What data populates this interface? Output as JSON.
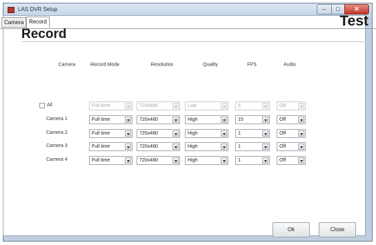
{
  "window": {
    "title": "LAS DVR Setup",
    "controls": {
      "minimize": "–",
      "maximize": "□",
      "close": "✕"
    }
  },
  "tabs": [
    {
      "label": "Camera",
      "active": false
    },
    {
      "label": "Record",
      "active": true
    }
  ],
  "corner_title": "Test",
  "section_title": "Record",
  "columns": [
    "Camera",
    "Record Mode",
    "Resolution",
    "Quality",
    "FPS",
    "Audio"
  ],
  "all_row": {
    "label": "All",
    "checked": false,
    "record_mode": "Full time",
    "resolution": "720x480",
    "quality": "Low",
    "fps": "6",
    "audio": "Off"
  },
  "rows": [
    {
      "camera": "Camera 1",
      "record_mode": "Full time",
      "resolution": "720x480",
      "quality": "High",
      "fps": "15",
      "audio": "Off"
    },
    {
      "camera": "Camera 2",
      "record_mode": "Full time",
      "resolution": "720x480",
      "quality": "High",
      "fps": "1",
      "audio": "Off"
    },
    {
      "camera": "Camera 3",
      "record_mode": "Full time",
      "resolution": "720x480",
      "quality": "High",
      "fps": "1",
      "audio": "Off"
    },
    {
      "camera": "Camera 4",
      "record_mode": "Full time",
      "resolution": "720x480",
      "quality": "High",
      "fps": "1",
      "audio": "Off"
    }
  ],
  "buttons": {
    "ok": "Ok",
    "close": "Close"
  },
  "colors": {
    "titlebar": "#c3d3e6",
    "close_button": "#c4392a",
    "window_frame": "#bfcfe0"
  }
}
